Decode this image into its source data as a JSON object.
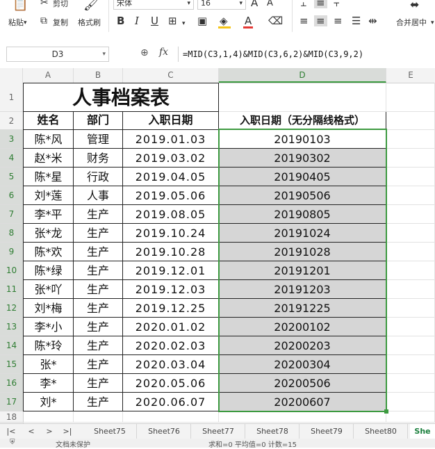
{
  "ribbon": {
    "paste_label": "粘贴",
    "cut_label": "剪切",
    "copy_label": "复制",
    "format_painter_label": "格式刷",
    "font_name": "宋体",
    "font_size": "16",
    "merge_center_label": "合并居中",
    "font_color": "#e53935",
    "fill_color": "#f5c518"
  },
  "formula_bar": {
    "name_box": "D3",
    "fx_label": "fx",
    "formula": "=MID(C3,1,4)&MID(C3,6,2)&MID(C3,9,2)"
  },
  "grid": {
    "columns": [
      "A",
      "B",
      "C",
      "D",
      "E"
    ],
    "title": "人事档案表",
    "headers": [
      "姓名",
      "部门",
      "入职日期",
      "入职日期（无分隔线格式）"
    ],
    "rows": [
      {
        "num": "3",
        "name": "陈*风",
        "dept": "管理",
        "date": "2019.01.03",
        "plain": "20190103"
      },
      {
        "num": "4",
        "name": "赵*米",
        "dept": "财务",
        "date": "2019.03.02",
        "plain": "20190302"
      },
      {
        "num": "5",
        "name": "陈*星",
        "dept": "行政",
        "date": "2019.04.05",
        "plain": "20190405"
      },
      {
        "num": "6",
        "name": "刘*莲",
        "dept": "人事",
        "date": "2019.05.06",
        "plain": "20190506"
      },
      {
        "num": "7",
        "name": "李*平",
        "dept": "生产",
        "date": "2019.08.05",
        "plain": "20190805"
      },
      {
        "num": "8",
        "name": "张*龙",
        "dept": "生产",
        "date": "2019.10.24",
        "plain": "20191024"
      },
      {
        "num": "9",
        "name": "陈*欢",
        "dept": "生产",
        "date": "2019.10.28",
        "plain": "20191028"
      },
      {
        "num": "10",
        "name": "陈*绿",
        "dept": "生产",
        "date": "2019.12.01",
        "plain": "20191201"
      },
      {
        "num": "11",
        "name": "张*吖",
        "dept": "生产",
        "date": "2019.12.03",
        "plain": "20191203"
      },
      {
        "num": "12",
        "name": "刘*梅",
        "dept": "生产",
        "date": "2019.12.25",
        "plain": "20191225"
      },
      {
        "num": "13",
        "name": "李*小",
        "dept": "生产",
        "date": "2020.01.02",
        "plain": "20200102"
      },
      {
        "num": "14",
        "name": "陈*玲",
        "dept": "生产",
        "date": "2020.02.03",
        "plain": "20200203"
      },
      {
        "num": "15",
        "name": "张*",
        "dept": "生产",
        "date": "2020.03.04",
        "plain": "20200304"
      },
      {
        "num": "16",
        "name": "李*",
        "dept": "生产",
        "date": "2020.05.06",
        "plain": "20200506"
      },
      {
        "num": "17",
        "name": "刘*",
        "dept": "生产",
        "date": "2020.06.07",
        "plain": "20200607"
      }
    ],
    "row_labels_top": [
      "1",
      "2"
    ],
    "row_label_last": "18",
    "selection_color": "#3c9a3f",
    "selection_fill": "#d6d6d6"
  },
  "tabs": {
    "sheets": [
      "Sheet75",
      "Sheet76",
      "Sheet77",
      "Sheet78",
      "Sheet79",
      "Sheet80",
      "She"
    ],
    "active_index": 6
  },
  "status": {
    "protect_label": "文档未保护",
    "summary": "求和=0  平均值=0  计数=15"
  }
}
